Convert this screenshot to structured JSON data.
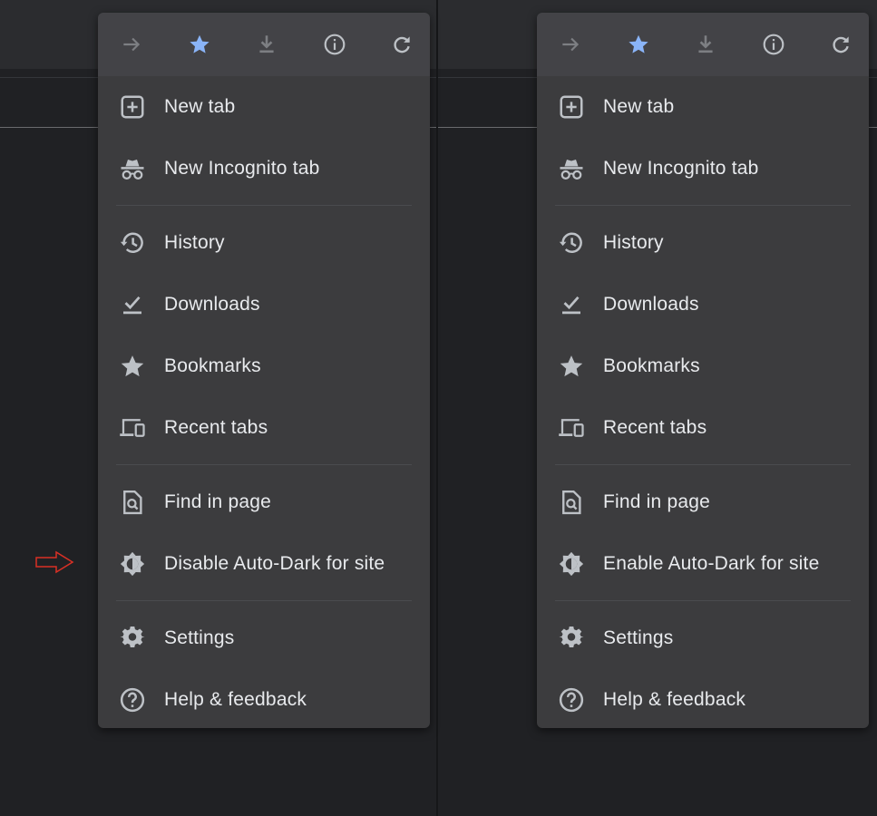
{
  "colors": {
    "background": "#202124",
    "menu": "#3c3c3e",
    "toolbar": "#434347",
    "text": "#e8eaed",
    "icon": "#bdc1c6",
    "bookmark_star": "#8ab4f8",
    "indicator_arrow": "#d93025"
  },
  "toolbar_icons": [
    "forward-arrow-icon",
    "bookmark-star-icon",
    "download-icon",
    "info-icon",
    "reload-icon"
  ],
  "menus": [
    {
      "items": [
        {
          "icon": "new-tab-icon",
          "label": "New tab"
        },
        {
          "icon": "incognito-icon",
          "label": "New Incognito tab"
        },
        {
          "icon": "history-icon",
          "label": "History"
        },
        {
          "icon": "downloads-check-icon",
          "label": "Downloads"
        },
        {
          "icon": "bookmarks-star-icon",
          "label": "Bookmarks"
        },
        {
          "icon": "recent-tabs-devices-icon",
          "label": "Recent tabs"
        },
        {
          "icon": "find-in-page-icon",
          "label": "Find in page"
        },
        {
          "icon": "auto-dark-icon",
          "label": "Disable Auto-Dark for site"
        },
        {
          "icon": "settings-gear-icon",
          "label": "Settings"
        },
        {
          "icon": "help-icon",
          "label": "Help & feedback"
        }
      ]
    },
    {
      "items": [
        {
          "icon": "new-tab-icon",
          "label": "New tab"
        },
        {
          "icon": "incognito-icon",
          "label": "New Incognito tab"
        },
        {
          "icon": "history-icon",
          "label": "History"
        },
        {
          "icon": "downloads-check-icon",
          "label": "Downloads"
        },
        {
          "icon": "bookmarks-star-icon",
          "label": "Bookmarks"
        },
        {
          "icon": "recent-tabs-devices-icon",
          "label": "Recent tabs"
        },
        {
          "icon": "find-in-page-icon",
          "label": "Find in page"
        },
        {
          "icon": "auto-dark-icon",
          "label": "Enable Auto-Dark for site"
        },
        {
          "icon": "settings-gear-icon",
          "label": "Settings"
        },
        {
          "icon": "help-icon",
          "label": "Help & feedback"
        }
      ]
    }
  ]
}
